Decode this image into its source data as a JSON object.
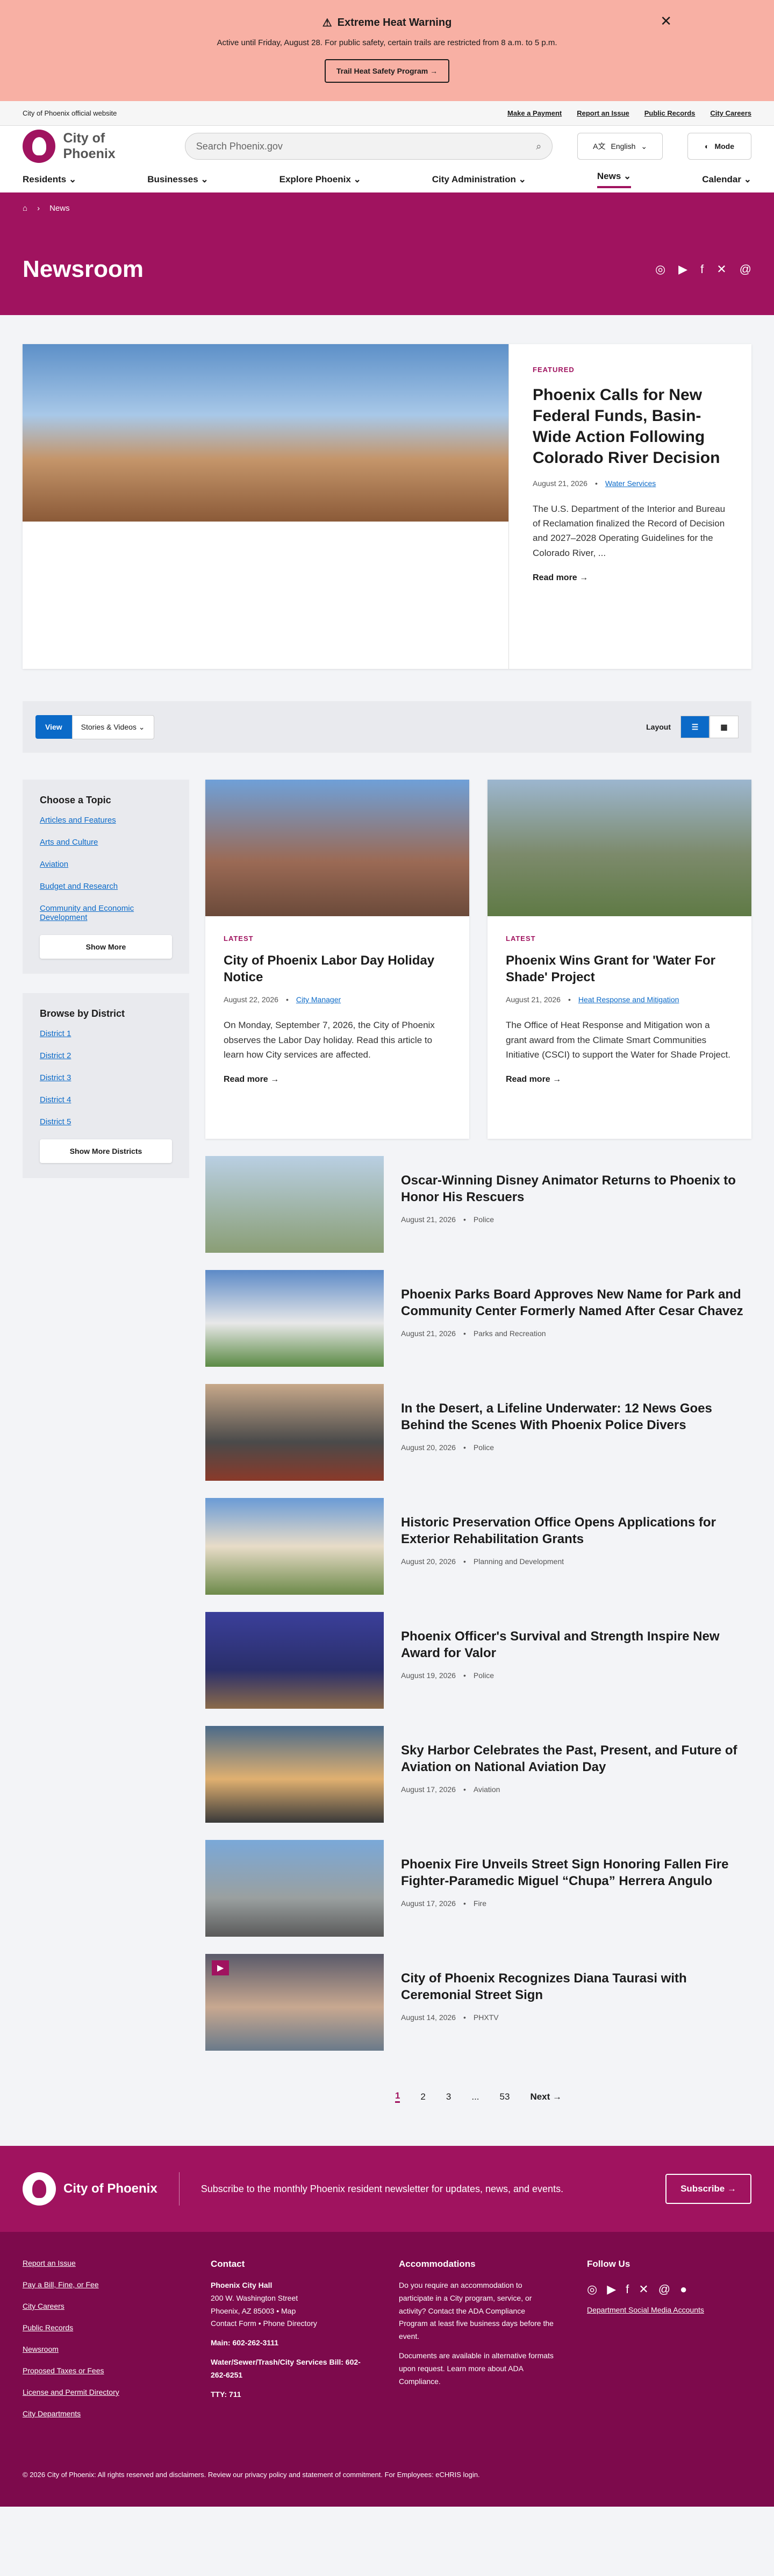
{
  "alert": {
    "title": "Extreme Heat Warning",
    "text": "Active until Friday, August 28. For public safety, certain trails are restricted from 8 a.m. to 5 p.m.",
    "button": "Trail Heat Safety Program"
  },
  "topbar": {
    "site": "City of Phoenix official website",
    "links": [
      "Make a Payment",
      "Report an Issue",
      "Public Records",
      "City Careers"
    ]
  },
  "header": {
    "logo": "City of Phoenix",
    "search_placeholder": "Search Phoenix.gov",
    "language": "English",
    "mode": "Mode"
  },
  "nav": [
    "Residents",
    "Businesses",
    "Explore Phoenix",
    "City Administration",
    "News",
    "Calendar"
  ],
  "breadcrumb": "News",
  "hero": {
    "title": "Newsroom"
  },
  "featured": {
    "kicker": "FEATURED",
    "title": "Phoenix Calls for New Federal Funds, Basin-Wide Action Following Colorado River Decision",
    "date": "August 21, 2026",
    "tag": "Water Services",
    "summary": "The U.S. Department of the Interior and Bureau of Reclamation finalized the Record of Decision and 2027–2028 Operating Guidelines for the Colorado River, ...",
    "more": "Read more"
  },
  "toolbar": {
    "view": "View",
    "select": "Stories & Videos",
    "layout": "Layout"
  },
  "topics": {
    "title": "Choose a Topic",
    "items": [
      "Articles and Features",
      "Arts and Culture",
      "Aviation",
      "Budget and Research",
      "Community and Economic Development"
    ],
    "button": "Show More"
  },
  "districts": {
    "title": "Browse by District",
    "items": [
      "District 1",
      "District 2",
      "District 3",
      "District 4",
      "District 5"
    ],
    "button": "Show More Districts"
  },
  "cards": [
    {
      "kicker": "LATEST",
      "title": "City of Phoenix Labor Day Holiday Notice",
      "date": "August 22, 2026",
      "tag": "City Manager",
      "summary": "On Monday, September 7, 2026, the City of Phoenix observes the Labor Day holiday. Read this article to learn how City services are affected.",
      "more": "Read more"
    },
    {
      "kicker": "LATEST",
      "title": "Phoenix Wins Grant for 'Water For Shade' Project",
      "date": "August 21, 2026",
      "tag": "Heat Response and Mitigation",
      "summary": "The Office of Heat Response and Mitigation won a grant award from the Climate Smart Communities Initiative (CSCI) to support the Water for Shade Project.",
      "more": "Read more"
    }
  ],
  "rows": [
    {
      "title": "Oscar-Winning Disney Animator Returns to Phoenix to Honor His Rescuers",
      "date": "August 21, 2026",
      "tag": "Police"
    },
    {
      "title": "Phoenix Parks Board Approves New Name for Park and Community Center Formerly Named After Cesar Chavez",
      "date": "August 21, 2026",
      "tag": "Parks and Recreation"
    },
    {
      "title": "In the Desert, a Lifeline Underwater: 12 News Goes Behind the Scenes With Phoenix Police Divers",
      "date": "August 20, 2026",
      "tag": "Police"
    },
    {
      "title": "Historic Preservation Office Opens Applications for Exterior Rehabilitation Grants",
      "date": "August 20, 2026",
      "tag": "Planning and Development"
    },
    {
      "title": "Phoenix Officer's Survival and Strength Inspire New Award for Valor",
      "date": "August 19, 2026",
      "tag": "Police"
    },
    {
      "title": "Sky Harbor Celebrates the Past, Present, and Future of Aviation on National Aviation Day",
      "date": "August 17, 2026",
      "tag": "Aviation"
    },
    {
      "title": "Phoenix Fire Unveils Street Sign Honoring Fallen Fire Fighter-Paramedic Miguel “Chupa” Herrera Angulo",
      "date": "August 17, 2026",
      "tag": "Fire"
    },
    {
      "title": "City of Phoenix Recognizes Diana Taurasi with Ceremonial Street Sign",
      "date": "August 14, 2026",
      "tag": "PHXTV"
    }
  ],
  "pager": {
    "pages": [
      "1",
      "2",
      "3",
      "...",
      "53"
    ],
    "next": "Next"
  },
  "newsletter": {
    "text": "Subscribe to the monthly Phoenix resident newsletter for updates, news, and events.",
    "button": "Subscribe"
  },
  "footer": {
    "links": [
      "Report an Issue",
      "Pay a Bill, Fine, or Fee",
      "City Careers",
      "Public Records",
      "Newsroom",
      "Proposed Taxes or Fees",
      "License and Permit Directory",
      "City Departments"
    ],
    "contact_title": "Contact",
    "hall": "Phoenix City Hall",
    "address": "200 W. Washington Street",
    "city": "Phoenix, AZ 85003 • Map",
    "forms": "Contact Form • Phone Directory",
    "main": "Main: 602-262-3111",
    "bill": "Water/Sewer/Trash/City Services Bill: 602-262-6251",
    "tty": "TTY: 711",
    "acc_title": "Accommodations",
    "acc_text": "Do you require an accommodation to participate in a City program, service, or activity? Contact the ADA Compliance Program at least five business days before the event.",
    "acc_text2": "Documents are available in alternative formats upon request. Learn more about ADA Compliance.",
    "follow_title": "Follow Us",
    "social_link": "Department Social Media Accounts"
  },
  "legal": "© 2026 City of Phoenix: All rights reserved and disclaimers. Review our privacy policy and statement of commitment. For Employees: eCHRIS login."
}
